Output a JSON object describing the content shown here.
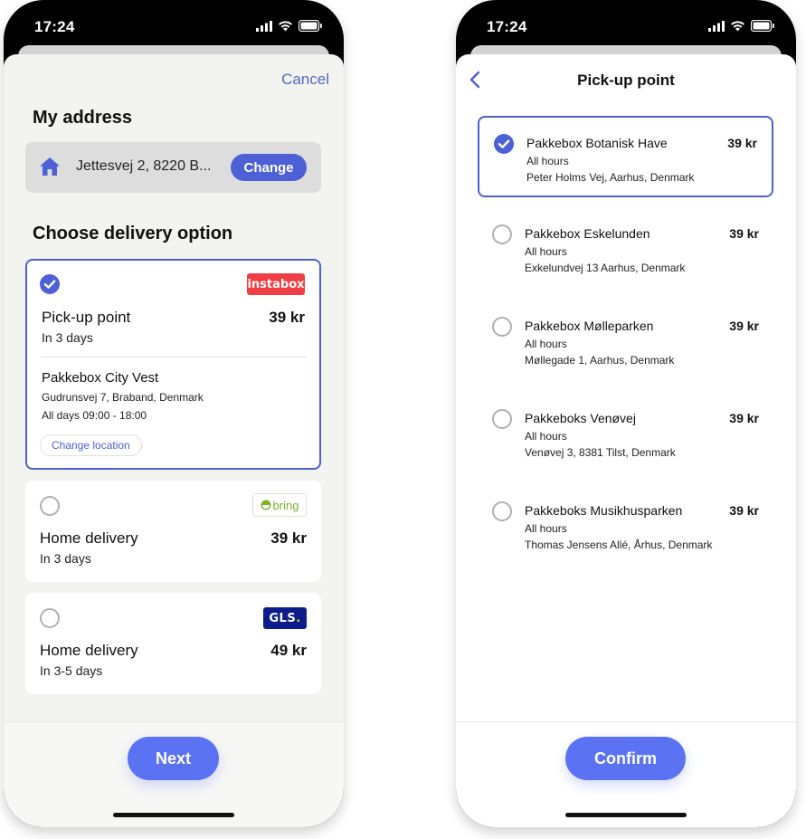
{
  "status_bar": {
    "time": "17:24"
  },
  "delivery_screen": {
    "cancel_label": "Cancel",
    "address_title": "My address",
    "address_value": "Jettesvej 2, 8220 B...",
    "change_label": "Change",
    "options_title": "Choose delivery option",
    "options": [
      {
        "carrier_logo": "instabox",
        "title": "Pick-up point",
        "subtitle": "In 3 days",
        "price": "39 kr",
        "selected": true,
        "pickup_name": "Pakkebox City Vest",
        "pickup_address": "Gudrunsvej 7, Braband, Denmark",
        "pickup_hours": "All days 09:00 - 18:00",
        "change_location_label": "Change location"
      },
      {
        "carrier_logo": "bring",
        "title": "Home delivery",
        "subtitle": "In 3 days",
        "price": "39 kr",
        "selected": false
      },
      {
        "carrier_logo": "GLS.",
        "title": "Home delivery",
        "subtitle": "In 3-5 days",
        "price": "49 kr",
        "selected": false
      }
    ],
    "next_label": "Next"
  },
  "pickup_screen": {
    "title": "Pick-up point",
    "items": [
      {
        "name": "Pakkebox Botanisk Have",
        "hours": "All hours",
        "address": "Peter Holms Vej, Aarhus, Denmark",
        "price": "39 kr",
        "selected": true
      },
      {
        "name": "Pakkebox Eskelunden",
        "hours": "All hours",
        "address": "Exkelundvej 13 Aarhus, Denmark",
        "price": "39 kr",
        "selected": false
      },
      {
        "name": "Pakkebox Mølleparken",
        "hours": "All hours",
        "address": "Møllegade 1, Aarhus, Denmark",
        "price": "39 kr",
        "selected": false
      },
      {
        "name": "Pakkeboks Venøvej",
        "hours": "All hours",
        "address": "Venøvej 3, 8381 Tilst, Denmark",
        "price": "39 kr",
        "selected": false
      },
      {
        "name": "Pakkeboks Musikhusparken",
        "hours": "All hours",
        "address": "Thomas Jensens Allé, Århus, Denmark",
        "price": "39 kr",
        "selected": false
      }
    ],
    "confirm_label": "Confirm"
  },
  "colors": {
    "accent": "#4d60d6",
    "button": "#5b72f2",
    "instabox": "#ef3e44",
    "gls": "#0b1d8a"
  }
}
